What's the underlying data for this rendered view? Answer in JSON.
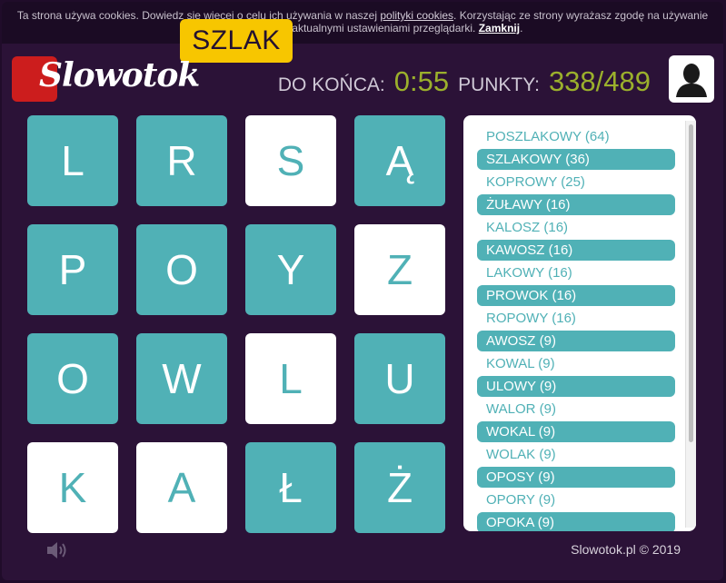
{
  "cookie": {
    "text_before": "Ta strona używa cookies. Dowiedz się więcej o celu ich używania w naszej ",
    "link": "polityki cookies",
    "text_after": ". Korzystając ze strony wyrażasz zgodę na używanie cookies zgodnie z aktualnymi ustawieniami przeglądarki. ",
    "close": "Zamknij",
    "end": "."
  },
  "current_word": "SZLAK",
  "logo": {
    "text": "Slowotok"
  },
  "status": {
    "time_label": "DO KOŃCA:",
    "time_value": "0:55",
    "points_label": "PUNKTY:",
    "points_value": "338/489"
  },
  "board": [
    [
      {
        "letter": "L",
        "selected": false
      },
      {
        "letter": "R",
        "selected": false
      },
      {
        "letter": "S",
        "selected": true
      },
      {
        "letter": "Ą",
        "selected": false
      }
    ],
    [
      {
        "letter": "P",
        "selected": false
      },
      {
        "letter": "O",
        "selected": false
      },
      {
        "letter": "Y",
        "selected": false
      },
      {
        "letter": "Z",
        "selected": true
      }
    ],
    [
      {
        "letter": "O",
        "selected": false
      },
      {
        "letter": "W",
        "selected": false
      },
      {
        "letter": "L",
        "selected": true
      },
      {
        "letter": "U",
        "selected": false
      }
    ],
    [
      {
        "letter": "K",
        "selected": true
      },
      {
        "letter": "A",
        "selected": true
      },
      {
        "letter": "Ł",
        "selected": false
      },
      {
        "letter": "Ż",
        "selected": false
      }
    ]
  ],
  "words": [
    {
      "text": "POSZLAKOWY (64)",
      "found": false
    },
    {
      "text": "SZLAKOWY (36)",
      "found": true
    },
    {
      "text": "KOPROWY (25)",
      "found": false
    },
    {
      "text": "ŻUŁAWY (16)",
      "found": true
    },
    {
      "text": "KALOSZ (16)",
      "found": false
    },
    {
      "text": "KAWOSZ (16)",
      "found": true
    },
    {
      "text": "LAKOWY (16)",
      "found": false
    },
    {
      "text": "PROWOK (16)",
      "found": true
    },
    {
      "text": "ROPOWY (16)",
      "found": false
    },
    {
      "text": "AWOSZ (9)",
      "found": true
    },
    {
      "text": "KOWAL (9)",
      "found": false
    },
    {
      "text": "ULOWY (9)",
      "found": true
    },
    {
      "text": "WALOR (9)",
      "found": false
    },
    {
      "text": "WOKAL (9)",
      "found": true
    },
    {
      "text": "WOLAK (9)",
      "found": false
    },
    {
      "text": "OPOSY (9)",
      "found": true
    },
    {
      "text": "OPORY (9)",
      "found": false
    },
    {
      "text": "OPOKA (9)",
      "found": true
    }
  ],
  "footer": {
    "copyright": "Slowotok.pl © 2019"
  },
  "icons": {
    "sound": "speaker-icon",
    "avatar": "user-avatar-icon"
  },
  "colors": {
    "tile": "#50b1b6",
    "accent": "#f7c600",
    "value": "#9bb02c",
    "logo": "#cc1d1d"
  }
}
